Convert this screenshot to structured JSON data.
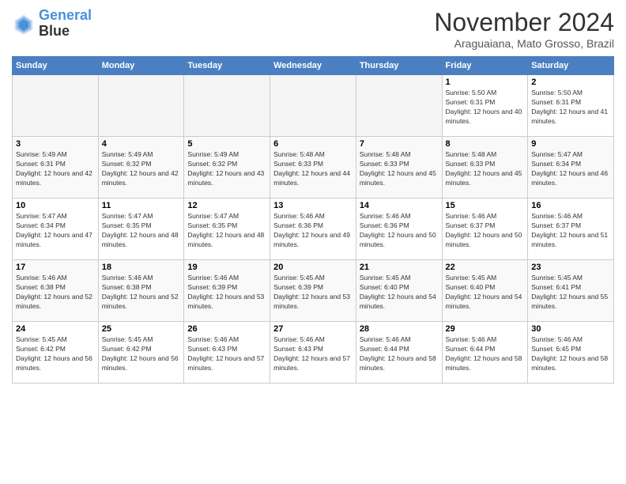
{
  "header": {
    "logo_line1": "General",
    "logo_line2": "Blue",
    "month_title": "November 2024",
    "location": "Araguaiana, Mato Grosso, Brazil"
  },
  "days_of_week": [
    "Sunday",
    "Monday",
    "Tuesday",
    "Wednesday",
    "Thursday",
    "Friday",
    "Saturday"
  ],
  "weeks": [
    [
      {
        "day": "",
        "empty": true
      },
      {
        "day": "",
        "empty": true
      },
      {
        "day": "",
        "empty": true
      },
      {
        "day": "",
        "empty": true
      },
      {
        "day": "",
        "empty": true
      },
      {
        "day": "1",
        "sunrise": "5:50 AM",
        "sunset": "6:31 PM",
        "daylight": "12 hours and 40 minutes."
      },
      {
        "day": "2",
        "sunrise": "5:50 AM",
        "sunset": "6:31 PM",
        "daylight": "12 hours and 41 minutes."
      }
    ],
    [
      {
        "day": "3",
        "sunrise": "5:49 AM",
        "sunset": "6:31 PM",
        "daylight": "12 hours and 42 minutes."
      },
      {
        "day": "4",
        "sunrise": "5:49 AM",
        "sunset": "6:32 PM",
        "daylight": "12 hours and 42 minutes."
      },
      {
        "day": "5",
        "sunrise": "5:49 AM",
        "sunset": "6:32 PM",
        "daylight": "12 hours and 43 minutes."
      },
      {
        "day": "6",
        "sunrise": "5:48 AM",
        "sunset": "6:33 PM",
        "daylight": "12 hours and 44 minutes."
      },
      {
        "day": "7",
        "sunrise": "5:48 AM",
        "sunset": "6:33 PM",
        "daylight": "12 hours and 45 minutes."
      },
      {
        "day": "8",
        "sunrise": "5:48 AM",
        "sunset": "6:33 PM",
        "daylight": "12 hours and 45 minutes."
      },
      {
        "day": "9",
        "sunrise": "5:47 AM",
        "sunset": "6:34 PM",
        "daylight": "12 hours and 46 minutes."
      }
    ],
    [
      {
        "day": "10",
        "sunrise": "5:47 AM",
        "sunset": "6:34 PM",
        "daylight": "12 hours and 47 minutes."
      },
      {
        "day": "11",
        "sunrise": "5:47 AM",
        "sunset": "6:35 PM",
        "daylight": "12 hours and 48 minutes."
      },
      {
        "day": "12",
        "sunrise": "5:47 AM",
        "sunset": "6:35 PM",
        "daylight": "12 hours and 48 minutes."
      },
      {
        "day": "13",
        "sunrise": "5:46 AM",
        "sunset": "6:36 PM",
        "daylight": "12 hours and 49 minutes."
      },
      {
        "day": "14",
        "sunrise": "5:46 AM",
        "sunset": "6:36 PM",
        "daylight": "12 hours and 50 minutes."
      },
      {
        "day": "15",
        "sunrise": "5:46 AM",
        "sunset": "6:37 PM",
        "daylight": "12 hours and 50 minutes."
      },
      {
        "day": "16",
        "sunrise": "5:46 AM",
        "sunset": "6:37 PM",
        "daylight": "12 hours and 51 minutes."
      }
    ],
    [
      {
        "day": "17",
        "sunrise": "5:46 AM",
        "sunset": "6:38 PM",
        "daylight": "12 hours and 52 minutes."
      },
      {
        "day": "18",
        "sunrise": "5:46 AM",
        "sunset": "6:38 PM",
        "daylight": "12 hours and 52 minutes."
      },
      {
        "day": "19",
        "sunrise": "5:46 AM",
        "sunset": "6:39 PM",
        "daylight": "12 hours and 53 minutes."
      },
      {
        "day": "20",
        "sunrise": "5:45 AM",
        "sunset": "6:39 PM",
        "daylight": "12 hours and 53 minutes."
      },
      {
        "day": "21",
        "sunrise": "5:45 AM",
        "sunset": "6:40 PM",
        "daylight": "12 hours and 54 minutes."
      },
      {
        "day": "22",
        "sunrise": "5:45 AM",
        "sunset": "6:40 PM",
        "daylight": "12 hours and 54 minutes."
      },
      {
        "day": "23",
        "sunrise": "5:45 AM",
        "sunset": "6:41 PM",
        "daylight": "12 hours and 55 minutes."
      }
    ],
    [
      {
        "day": "24",
        "sunrise": "5:45 AM",
        "sunset": "6:42 PM",
        "daylight": "12 hours and 56 minutes."
      },
      {
        "day": "25",
        "sunrise": "5:45 AM",
        "sunset": "6:42 PM",
        "daylight": "12 hours and 56 minutes."
      },
      {
        "day": "26",
        "sunrise": "5:46 AM",
        "sunset": "6:43 PM",
        "daylight": "12 hours and 57 minutes."
      },
      {
        "day": "27",
        "sunrise": "5:46 AM",
        "sunset": "6:43 PM",
        "daylight": "12 hours and 57 minutes."
      },
      {
        "day": "28",
        "sunrise": "5:46 AM",
        "sunset": "6:44 PM",
        "daylight": "12 hours and 58 minutes."
      },
      {
        "day": "29",
        "sunrise": "5:46 AM",
        "sunset": "6:44 PM",
        "daylight": "12 hours and 58 minutes."
      },
      {
        "day": "30",
        "sunrise": "5:46 AM",
        "sunset": "6:45 PM",
        "daylight": "12 hours and 58 minutes."
      }
    ]
  ]
}
